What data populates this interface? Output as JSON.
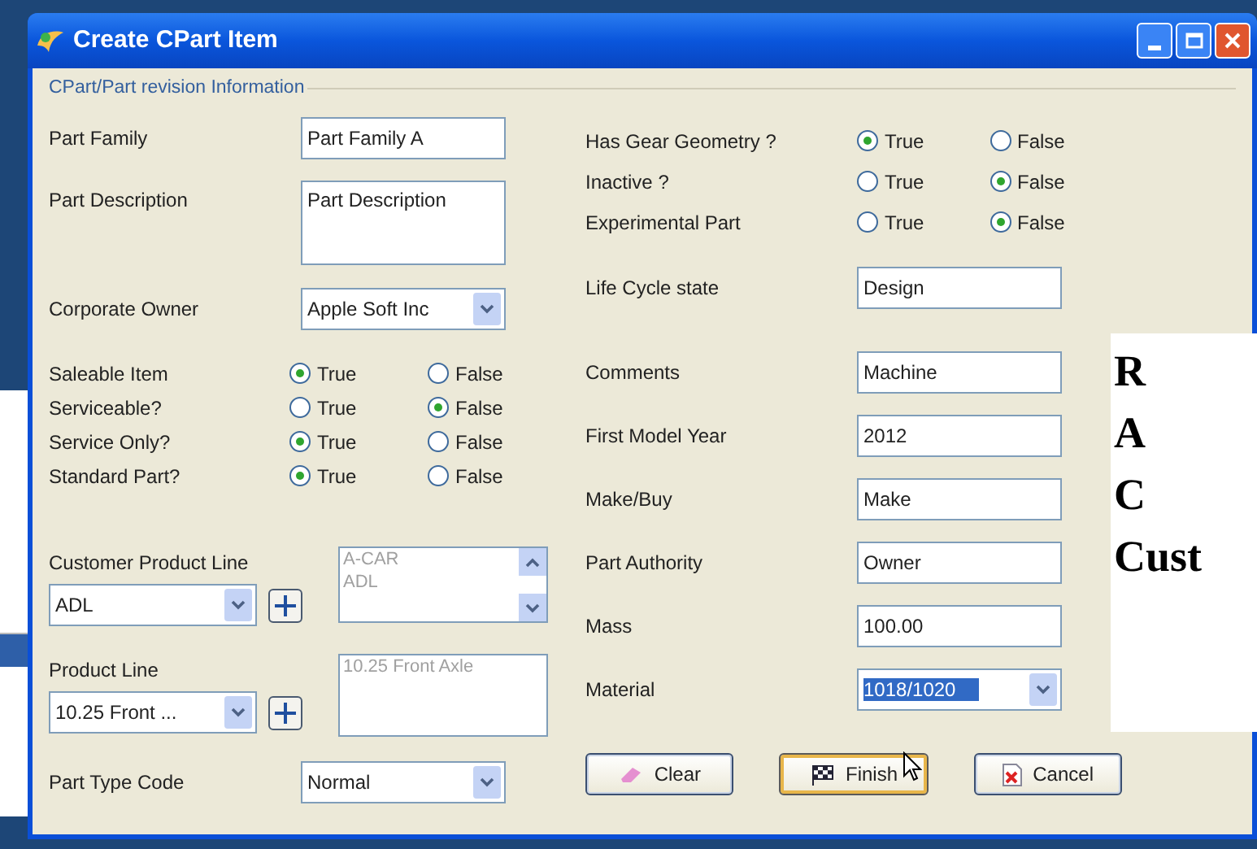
{
  "window": {
    "title": "Create CPart Item"
  },
  "group_label": "CPart/Part revision Information",
  "left_fields": [
    {
      "kind": "text",
      "label": "Part Family",
      "value": "Part Family A"
    },
    {
      "kind": "textarea",
      "label": "Part Description",
      "value": "Part Description"
    },
    {
      "kind": "combo",
      "label": "Corporate Owner",
      "value": "Apple Soft Inc"
    },
    {
      "kind": "radio",
      "label": "Saleable Item",
      "options": [
        {
          "label": "True",
          "selected": true
        },
        {
          "label": "False",
          "selected": false
        }
      ]
    },
    {
      "kind": "radio",
      "label": "Serviceable?",
      "options": [
        {
          "label": "True",
          "selected": false
        },
        {
          "label": "False",
          "selected": true
        }
      ]
    },
    {
      "kind": "radio",
      "label": "Service Only?",
      "options": [
        {
          "label": "True",
          "selected": true
        },
        {
          "label": "False",
          "selected": false
        }
      ]
    },
    {
      "kind": "radio",
      "label": "Standard Part?",
      "options": [
        {
          "label": "True",
          "selected": true
        },
        {
          "label": "False",
          "selected": false
        }
      ]
    }
  ],
  "line_pickers": [
    {
      "label": "Customer Product Line",
      "value": "ADL",
      "list_items": [
        "A-CAR",
        "ADL"
      ],
      "scrollable": true
    },
    {
      "label": "Product Line",
      "value": "10.25 Front ...",
      "list_items": [
        "10.25 Front Axle"
      ],
      "scrollable": false
    }
  ],
  "part_type_code": {
    "label": "Part Type Code",
    "value": "Normal"
  },
  "right_fields": [
    {
      "kind": "radio",
      "label": "Has Gear Geometry ?",
      "options": [
        {
          "label": "True",
          "selected": true
        },
        {
          "label": "False",
          "selected": false
        }
      ]
    },
    {
      "kind": "radio",
      "label": "Inactive ?",
      "options": [
        {
          "label": "True",
          "selected": false
        },
        {
          "label": "False",
          "selected": true
        }
      ]
    },
    {
      "kind": "radio",
      "label": "Experimental Part",
      "options": [
        {
          "label": "True",
          "selected": false
        },
        {
          "label": "False",
          "selected": true
        }
      ]
    },
    {
      "kind": "text",
      "label": "Life Cycle state",
      "value": "Design"
    },
    {
      "kind": "text",
      "label": "Comments",
      "value": "Machine"
    },
    {
      "kind": "text",
      "label": "First Model Year",
      "value": "2012"
    },
    {
      "kind": "text",
      "label": "Make/Buy",
      "value": "Make"
    },
    {
      "kind": "text",
      "label": "Part Authority",
      "value": "Owner"
    },
    {
      "kind": "text",
      "label": "Mass",
      "value": "100.00"
    },
    {
      "kind": "combo",
      "label": "Material",
      "value": "1018/1020",
      "highlighted": true
    }
  ],
  "buttons": [
    {
      "kind": "clear",
      "label": "Clear",
      "focused": false
    },
    {
      "kind": "finish",
      "label": "Finish",
      "focused": true
    },
    {
      "kind": "cancel",
      "label": "Cancel",
      "focused": false
    }
  ],
  "side_text": [
    "R",
    "A",
    "C",
    "Cust"
  ]
}
